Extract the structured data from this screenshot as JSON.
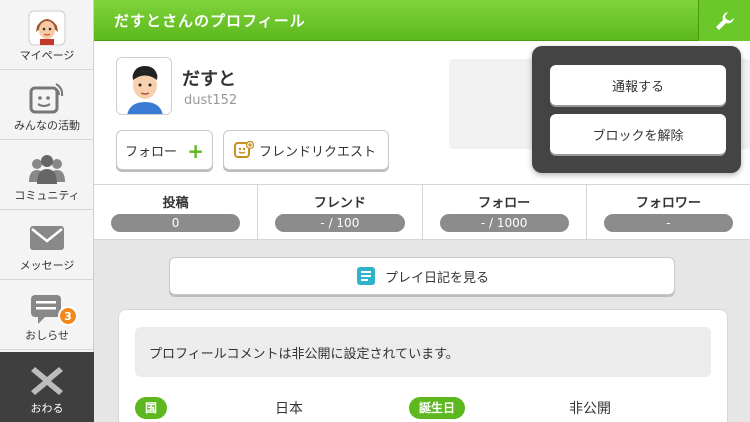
{
  "sidebar": {
    "items": [
      {
        "label": "マイページ",
        "icon": "avatar-icon"
      },
      {
        "label": "みんなの活動",
        "icon": "activity-icon"
      },
      {
        "label": "コミュニティ",
        "icon": "community-icon"
      },
      {
        "label": "メッセージ",
        "icon": "envelope-icon"
      },
      {
        "label": "おしらせ",
        "icon": "notification-icon",
        "badge": "3"
      },
      {
        "label": "おわる",
        "icon": "close-icon"
      }
    ]
  },
  "header": {
    "title": "だすとさんのプロフィール",
    "tool_icon": "wrench-icon"
  },
  "profile": {
    "name": "だすと",
    "id": "dust152",
    "follow_label": "フォロー",
    "friend_request_label": "フレンドリクエスト"
  },
  "stats": [
    {
      "label": "投稿",
      "value": "0"
    },
    {
      "label": "フレンド",
      "value": "- / 100"
    },
    {
      "label": "フォロー",
      "value": "- / 1000"
    },
    {
      "label": "フォロワー",
      "value": "-"
    }
  ],
  "diary_button": "プレイ日記を見る",
  "comment": "プロフィールコメントは非公開に設定されています。",
  "details": {
    "country_tag": "国",
    "country_value": "日本",
    "birthday_tag": "誕生日",
    "birthday_value": "非公開"
  },
  "popup": {
    "report_label": "通報する",
    "unblock_label": "ブロックを解除"
  },
  "colors": {
    "accent_green": "#5cb81e",
    "badge_orange": "#f08a1e"
  }
}
